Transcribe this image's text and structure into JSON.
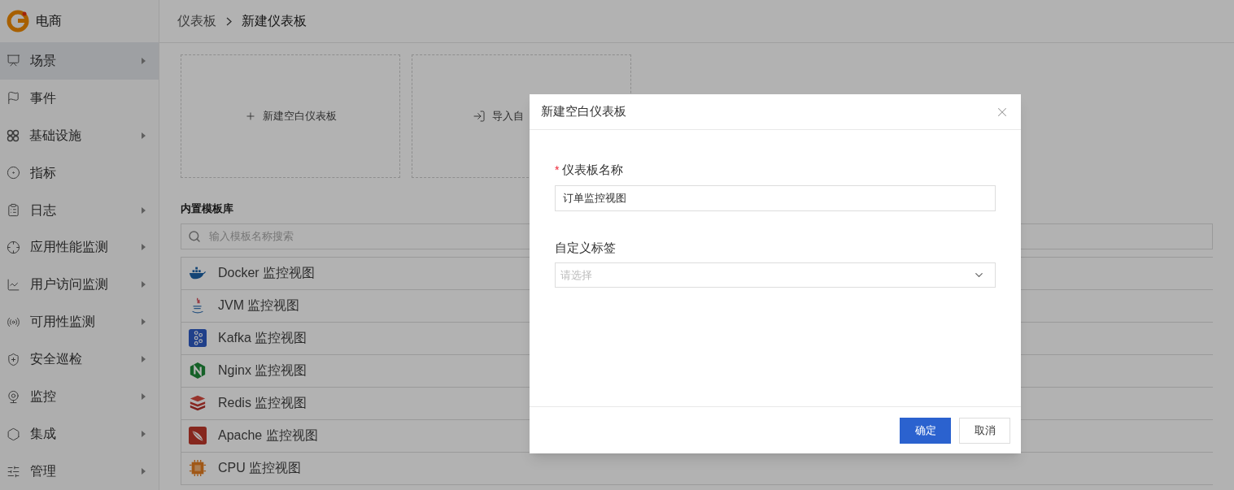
{
  "app": {
    "name": "电商"
  },
  "sidebar": {
    "items": [
      {
        "label": "场景",
        "selected": true,
        "has_submenu": true
      },
      {
        "label": "事件",
        "selected": false,
        "has_submenu": false
      },
      {
        "label": "基础设施",
        "selected": false,
        "has_submenu": true
      },
      {
        "label": "指标",
        "selected": false,
        "has_submenu": false
      },
      {
        "label": "日志",
        "selected": false,
        "has_submenu": true
      },
      {
        "label": "应用性能监测",
        "selected": false,
        "has_submenu": true
      },
      {
        "label": "用户访问监测",
        "selected": false,
        "has_submenu": true
      },
      {
        "label": "可用性监测",
        "selected": false,
        "has_submenu": true
      },
      {
        "label": "安全巡检",
        "selected": false,
        "has_submenu": true
      },
      {
        "label": "监控",
        "selected": false,
        "has_submenu": true
      },
      {
        "label": "集成",
        "selected": false,
        "has_submenu": true
      },
      {
        "label": "管理",
        "selected": false,
        "has_submenu": true
      }
    ]
  },
  "breadcrumb": [
    {
      "label": "仪表板"
    },
    {
      "label": "新建仪表板"
    }
  ],
  "create_cards": [
    {
      "label": "新建空白仪表板"
    },
    {
      "label": "导入自"
    }
  ],
  "templates": {
    "title": "内置模板库",
    "search": {
      "placeholder": "输入模板名称搜索"
    },
    "items": [
      {
        "label": "Docker 监控视图"
      },
      {
        "label": "JVM 监控视图"
      },
      {
        "label": "Kafka 监控视图"
      },
      {
        "label": "Nginx 监控视图"
      },
      {
        "label": "Redis 监控视图"
      },
      {
        "label": "Apache 监控视图"
      },
      {
        "label": "CPU 监控视图"
      }
    ]
  },
  "dialog": {
    "title": "新建空白仪表板",
    "fields": [
      {
        "kind": "text",
        "label": "仪表板名称",
        "required_mark": "*",
        "value": "订单监控视图"
      },
      {
        "kind": "select",
        "label": "自定义标签",
        "placeholder": "请选择"
      }
    ],
    "buttons": [
      {
        "label": "确定",
        "primary": true
      },
      {
        "label": "取消",
        "primary": false
      }
    ]
  }
}
